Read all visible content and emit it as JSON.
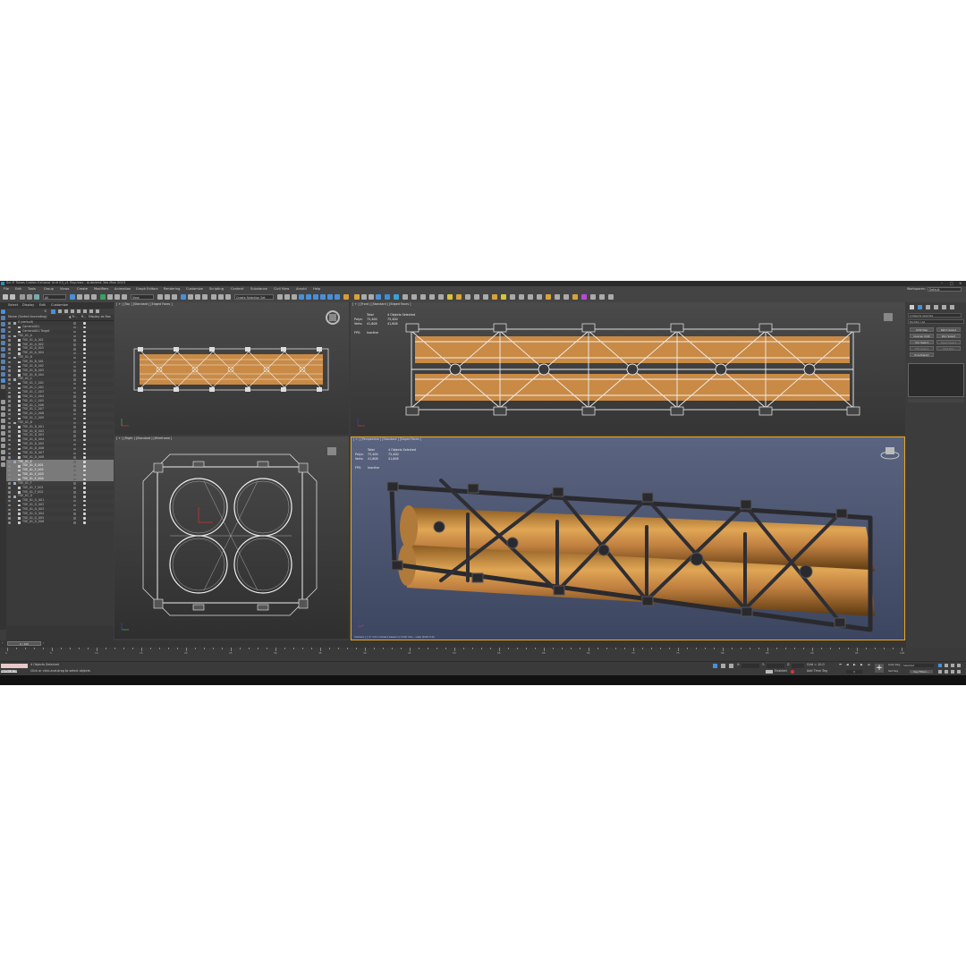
{
  "window": {
    "title": "Sci-Fi Tubes Cables Exhaust Unit 03_v1 Ray.max - Autodesk 3ds Max 2023"
  },
  "menu": {
    "items": [
      "File",
      "Edit",
      "Tools",
      "Group",
      "Views",
      "Create",
      "Modifiers",
      "Animation",
      "Graph Editors",
      "Rendering",
      "Customize",
      "Scripting",
      "Content",
      "Substance",
      "Civil View",
      "Arnold",
      "Help"
    ],
    "workspace_label": "Workspaces:",
    "workspace_value": "Default"
  },
  "toolbar": {
    "filter": "All",
    "view": "View",
    "selection_set": "Create Selection Set"
  },
  "explorer": {
    "tabs": [
      "Select",
      "Display",
      "Edit",
      "Customize"
    ],
    "columns": {
      "name": "Name (Sorted Ascending)",
      "frozen": "▲ Fr...",
      "renderable": "R...",
      "display": "Display as Box"
    },
    "rows": [
      {
        "name": "0 (default)",
        "indent": 1,
        "type": "layer"
      },
      {
        "name": "Camera001",
        "indent": 2
      },
      {
        "name": "Camera001.Target",
        "indent": 2
      },
      {
        "name": "TSE_01_A",
        "indent": 1,
        "type": "layer"
      },
      {
        "name": "TSE_01_A_001",
        "indent": 2
      },
      {
        "name": "TSE_01_A_002",
        "indent": 2
      },
      {
        "name": "TSE_01_A_003",
        "indent": 2
      },
      {
        "name": "TSE_01_A_004",
        "indent": 2
      },
      {
        "name": "TSE_01_B",
        "indent": 1,
        "type": "layer"
      },
      {
        "name": "TSE_01_B_001",
        "indent": 2
      },
      {
        "name": "TSE_01_B_002",
        "indent": 2
      },
      {
        "name": "TSE_01_B_003",
        "indent": 2
      },
      {
        "name": "TSE_01_B_004",
        "indent": 2
      },
      {
        "name": "TSE_01_C",
        "indent": 1,
        "type": "layer"
      },
      {
        "name": "TSE_01_C_001",
        "indent": 2
      },
      {
        "name": "TSE_01_C_002",
        "indent": 2
      },
      {
        "name": "TSE_01_C_003",
        "indent": 2
      },
      {
        "name": "TSE_01_C_004",
        "indent": 2
      },
      {
        "name": "TSE_01_C_005",
        "indent": 2
      },
      {
        "name": "TSE_01_C_006",
        "indent": 2
      },
      {
        "name": "TSE_01_C_007",
        "indent": 2
      },
      {
        "name": "TSE_01_C_008",
        "indent": 2
      },
      {
        "name": "TSE_01_C_009",
        "indent": 2
      },
      {
        "name": "TSE_01_D",
        "indent": 1,
        "type": "layer"
      },
      {
        "name": "TSE_01_D_001",
        "indent": 2
      },
      {
        "name": "TSE_01_D_002",
        "indent": 2
      },
      {
        "name": "TSE_01_D_003",
        "indent": 2
      },
      {
        "name": "TSE_01_D_004",
        "indent": 2
      },
      {
        "name": "TSE_01_D_005",
        "indent": 2
      },
      {
        "name": "TSE_01_D_006",
        "indent": 2
      },
      {
        "name": "TSE_01_D_007",
        "indent": 2
      },
      {
        "name": "TSE_01_D_008",
        "indent": 2
      },
      {
        "name": "TSE_01_E",
        "indent": 1,
        "type": "layer",
        "selected": true
      },
      {
        "name": "TSE_01_E_001",
        "indent": 2,
        "selected": true
      },
      {
        "name": "TSE_01_E_002",
        "indent": 2,
        "selected": true
      },
      {
        "name": "TSE_01_E_003",
        "indent": 2,
        "selected": true
      },
      {
        "name": "TSE_01_E_004",
        "indent": 2,
        "selected": true
      },
      {
        "name": "TSE_01_F",
        "indent": 1,
        "type": "layer"
      },
      {
        "name": "TSE_01_F_001",
        "indent": 2
      },
      {
        "name": "TSE_01_F_002",
        "indent": 2
      },
      {
        "name": "TSE_01_G",
        "indent": 1,
        "type": "layer"
      },
      {
        "name": "TSE_01_G_001",
        "indent": 2
      },
      {
        "name": "TSE_01_G_002",
        "indent": 2
      },
      {
        "name": "TSE_01_G_003",
        "indent": 2
      },
      {
        "name": "TSE_01_G_004",
        "indent": 2
      },
      {
        "name": "TSE_01_G_005",
        "indent": 2
      },
      {
        "name": "TSE_01_G_006",
        "indent": 2
      }
    ],
    "layer_explorer": "Layer Explorer",
    "selection_set": "Selection Set:"
  },
  "viewports": {
    "top": {
      "label": "[ + ] [Top ] [Standard ] [Edged Faces ]"
    },
    "front": {
      "label": "[ + ] [Front ] [Standard ] [Edged Faces ]"
    },
    "right": {
      "label": "[ + ] [Right ] [Standard ] [Wireframe ]"
    },
    "persp": {
      "label": "[ + ] [Perspective ] [Standard ] [Edged Faces ]",
      "bottom_text": "Camera [ ] (r) mm (camera based on 0.00 cds) - view [0.00 0.0]"
    }
  },
  "stats": {
    "total_label": "Total",
    "selected_label": "4 Objects Selected",
    "polys_label": "Polys:",
    "verts_label": "Verts:",
    "polys_total": "75,400",
    "polys_selected": "75,400",
    "verts_total": "41,608",
    "verts_selected": "41,608",
    "fps_label": "FPS:",
    "fps_value": "Inactive"
  },
  "command_panel": {
    "object_name": "4 Objects Selected",
    "modifier_list": "Modifier List",
    "buttons": [
      "UVW Map",
      "Patch Select",
      "Unwrap UVW",
      "Poly Select",
      "Vol. Select",
      "Mesh Select",
      "FFD Select",
      "Edit Poly",
      "Poly2Select"
    ]
  },
  "timeline": {
    "frame": "0 / 100",
    "ticks": [
      "0",
      "5",
      "10",
      "15",
      "20",
      "25",
      "30",
      "35",
      "40",
      "45",
      "50",
      "55",
      "60",
      "65",
      "70",
      "75",
      "80",
      "85",
      "90",
      "95",
      "100"
    ]
  },
  "status": {
    "selected": "4 Objects Selected",
    "prompt": "Click or click-and-drag to select objects",
    "script_label": "MAXScript Mi",
    "x": "X:",
    "y": "Y:",
    "z": "Z:",
    "grid": "Grid = 10.0",
    "selected_flag": "Enabled",
    "add_time_tag": "Add Time Tag",
    "auto_key": "Auto Key",
    "set_key": "Set Key",
    "key_mode": "Selected",
    "key_filters": "Key Filters...",
    "frame_value": "0"
  }
}
